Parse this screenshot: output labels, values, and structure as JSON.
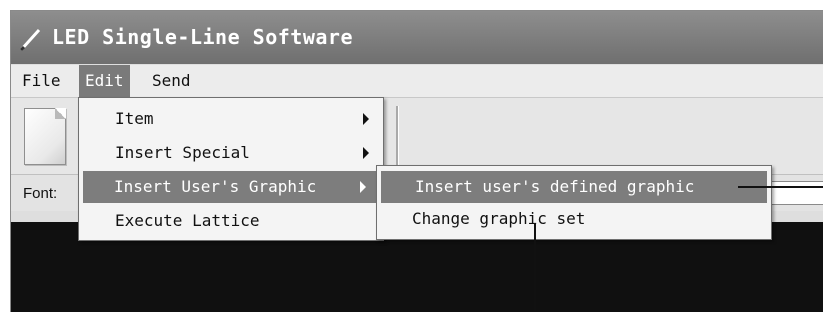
{
  "window": {
    "title": "LED Single-Line Software",
    "icon": "pencil-icon"
  },
  "menubar": {
    "items": [
      "File",
      "Edit",
      "Send"
    ],
    "active": "Edit"
  },
  "toolbar": {
    "new_document_icon": "new-document-icon"
  },
  "font_row": {
    "label": "Font:"
  },
  "edit_menu": {
    "items": [
      {
        "label": "Item",
        "has_submenu": true
      },
      {
        "label": "Insert Special",
        "has_submenu": true
      },
      {
        "label": "Insert User's Graphic",
        "has_submenu": true,
        "highlighted": true
      },
      {
        "label": "Execute Lattice",
        "has_submenu": false
      }
    ]
  },
  "submenu": {
    "items": [
      {
        "label": "Insert user's defined graphic",
        "highlighted": true
      },
      {
        "label": "Change graphic set"
      }
    ]
  },
  "colors": {
    "titlebar": "#7f7f7f",
    "highlight": "#7d7d7d",
    "canvas": "#101010"
  }
}
